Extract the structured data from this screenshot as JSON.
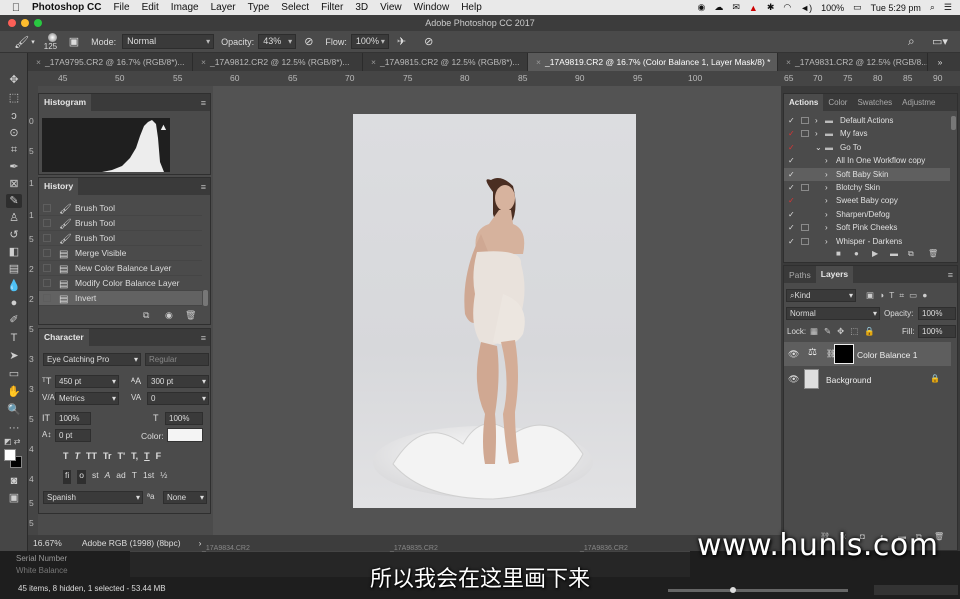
{
  "menubar": {
    "apple": "",
    "app": "Photoshop CC",
    "items": [
      "File",
      "Edit",
      "Image",
      "Layer",
      "Type",
      "Select",
      "Filter",
      "3D",
      "View",
      "Window",
      "Help"
    ],
    "battery": "100%",
    "clock": "Tue 5:29 pm"
  },
  "window_title": "Adobe Photoshop CC 2017",
  "options": {
    "brush_size": "125",
    "mode_label": "Mode:",
    "mode_value": "Normal",
    "opacity_label": "Opacity:",
    "opacity_value": "43%",
    "flow_label": "Flow:",
    "flow_value": "100%"
  },
  "tabs": [
    "_17A9795.CR2 @ 16.7% (RGB/8*)...",
    "_17A9812.CR2 @ 12.5% (RGB/8*)...",
    "_17A9815.CR2 @ 12.5% (RGB/8*)...",
    "_17A9819.CR2 @ 16.7% (Color Balance 1, Layer Mask/8) *",
    "_17A9831.CR2 @ 12.5% (RGB/8..."
  ],
  "ruler_left": {
    "h": [
      "45",
      "50",
      "55",
      "60",
      "65",
      "70",
      "75",
      "80",
      "85",
      "90",
      "95",
      "100"
    ],
    "v": [
      "0",
      "5",
      "1",
      "1",
      "5",
      "2",
      "2",
      "5",
      "3",
      "3",
      "5",
      "4",
      "4",
      "5",
      "5"
    ]
  },
  "ruler_right": [
    "65",
    "70",
    "75",
    "80",
    "85",
    "90"
  ],
  "histogram": {
    "title": "Histogram"
  },
  "history": {
    "title": "History",
    "items": [
      "Brush Tool",
      "Brush Tool",
      "Brush Tool",
      "Merge Visible",
      "New Color Balance Layer",
      "Modify Color Balance Layer",
      "Invert"
    ]
  },
  "character": {
    "title": "Character",
    "font": "Eye Catching Pro",
    "style": "Regular",
    "size": "450 pt",
    "leading": "300 pt",
    "kerning": "Metrics",
    "tracking": "0",
    "vscale": "100%",
    "hscale": "100%",
    "baseline": "0 pt",
    "color_label": "Color:",
    "language": "Spanish",
    "aa_label": "a",
    "aa": "None",
    "glyphs": [
      "T",
      "T",
      "TT",
      "Tr",
      "T'",
      "T,",
      "T",
      "F"
    ],
    "alts": [
      "fi",
      "o",
      "st",
      "A",
      "ad",
      "T",
      "1st",
      "½"
    ]
  },
  "actions": {
    "tabs": [
      "Actions",
      "Color",
      "Swatches",
      "Adjustme"
    ],
    "items": [
      {
        "label": "Default Actions",
        "type": "folder",
        "expanded": false
      },
      {
        "label": "My favs",
        "type": "folder",
        "expanded": false
      },
      {
        "label": "Go To",
        "type": "folder",
        "expanded": true
      },
      {
        "label": "All In One Workflow copy",
        "type": "action"
      },
      {
        "label": "Soft Baby Skin",
        "type": "action"
      },
      {
        "label": "Blotchy Skin",
        "type": "action"
      },
      {
        "label": "Sweet Baby copy",
        "type": "action"
      },
      {
        "label": "Sharpen/Defog",
        "type": "action"
      },
      {
        "label": "Soft Pink Cheeks",
        "type": "action"
      },
      {
        "label": "Whisper - Darkens",
        "type": "action"
      }
    ]
  },
  "layers": {
    "tabs": [
      "Paths",
      "Layers"
    ],
    "filter": "Kind",
    "blend": "Normal",
    "opacity_label": "Opacity:",
    "opacity": "100%",
    "lock_label": "Lock:",
    "fill_label": "Fill:",
    "fill": "100%",
    "items": [
      {
        "name": "Color Balance 1"
      },
      {
        "name": "Background"
      }
    ]
  },
  "status": {
    "zoom": "16.67%",
    "profile": "Adobe RGB (1998) (8bpc)"
  },
  "bottom": {
    "row1": "Serial Number",
    "row2": "White Balance",
    "filmstrip": [
      "_17A9834.CR2",
      "_17A9835.CR2",
      "_17A9836.CR2"
    ],
    "info": "45 items, 8 hidden, 1 selected - 53.44 MB"
  },
  "subtitle": "所以我会在这里画下来",
  "watermark": "www.hunls.com"
}
